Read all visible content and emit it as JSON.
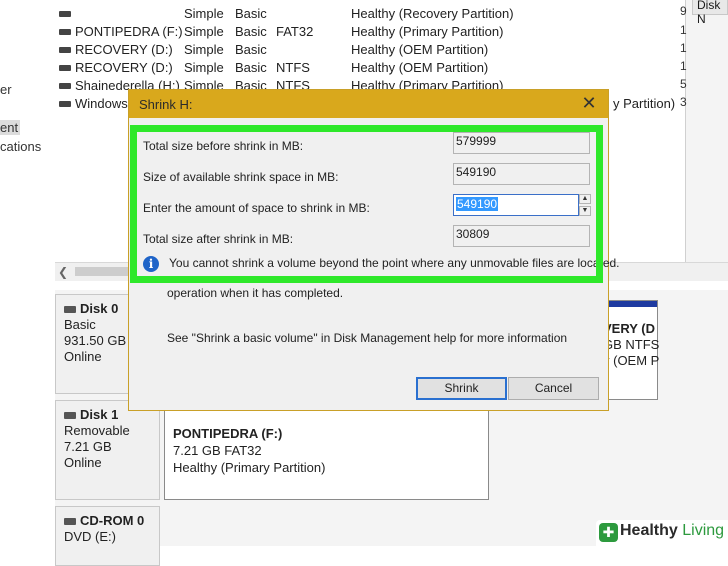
{
  "left_pane": {
    "items": [
      "er",
      "ent",
      "cations"
    ]
  },
  "volume_list": {
    "rows": [
      {
        "name": "",
        "layout": "Simple",
        "type": "Basic",
        "fs": "",
        "status": "Healthy (Recovery Partition)"
      },
      {
        "name": "PONTIPEDRA (F:)",
        "layout": "Simple",
        "type": "Basic",
        "fs": "FAT32",
        "status": "Healthy (Primary Partition)"
      },
      {
        "name": "RECOVERY (D:)",
        "layout": "Simple",
        "type": "Basic",
        "fs": "",
        "status": "Healthy (OEM Partition)"
      },
      {
        "name": "RECOVERY (D:)",
        "layout": "Simple",
        "type": "Basic",
        "fs": "NTFS",
        "status": "Healthy (OEM Partition)"
      },
      {
        "name": "Shainederella (H:)",
        "layout": "Simple",
        "type": "Basic",
        "fs": "NTFS",
        "status": "Healthy (Primary Partition)"
      },
      {
        "name": "Windows",
        "layout": "",
        "type": "",
        "fs": "",
        "status": "y Partition)"
      }
    ],
    "right_strip": [
      "9",
      "1",
      "1",
      "1",
      "5",
      "3"
    ],
    "right_header": "Disk N"
  },
  "disks": [
    {
      "name": "Disk 0",
      "kind": "Basic",
      "size": "931.50 GB",
      "state": "Online"
    },
    {
      "name": "Disk 1",
      "kind": "Removable",
      "size": "7.21 GB",
      "state": "Online"
    },
    {
      "name": "CD-ROM 0",
      "kind": "DVD (E:)",
      "size": "",
      "state": ""
    }
  ],
  "partition_pontipedra": {
    "title": "PONTIPEDRA  (F:)",
    "detail": "7.21 GB FAT32",
    "status": "Healthy (Primary Partition)"
  },
  "partition_recovery": {
    "title": "VERY (D",
    "detail": "GB NTFS",
    "status": "y (OEM P"
  },
  "dialog": {
    "title": "Shrink H:",
    "close": "✕",
    "total_before_label": "Total size before shrink in MB:",
    "total_before_value": "579999",
    "available_label": "Size of available shrink space in MB:",
    "available_value": "549190",
    "amount_label": "Enter the amount of space to shrink in MB:",
    "amount_value": "549190",
    "after_label": "Total size after shrink in MB:",
    "after_value": "30809",
    "warning_line1": "You cannot shrink a volume beyond the point where any unmovable files are located.",
    "warning_line3": "operation when it has completed.",
    "help_text": "See \"Shrink a basic volume\" in Disk Management help for more information",
    "shrink_button": "Shrink",
    "cancel_button": "Cancel"
  },
  "watermark": {
    "healthy": "Healthy",
    "living": " Living"
  },
  "colors": {
    "highlight_frame": "#2ee82a",
    "title_bar": "#d9a81c",
    "partition_bar": "#1e3aa0",
    "selection": "#3399ff"
  }
}
